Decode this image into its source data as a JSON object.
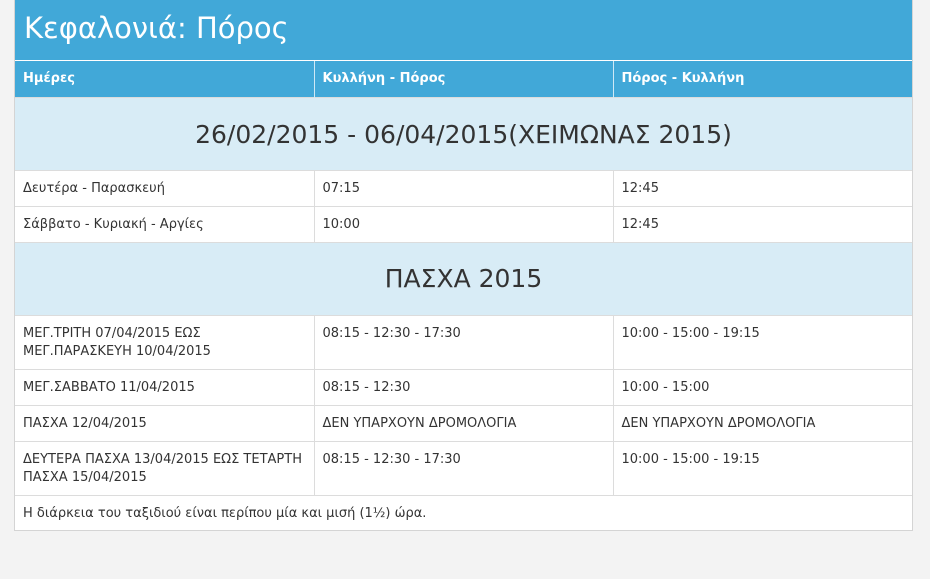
{
  "page": {
    "title": "Κεφαλονιά: Πόρος"
  },
  "table": {
    "headers": [
      "Ημέρες",
      "Κυλλήνη - Πόρος",
      "Πόρος - Κυλλήνη"
    ],
    "sections": [
      {
        "heading": "26/02/2015 - 06/04/2015(ΧΕΙΜΩΝΑΣ 2015)",
        "rows": [
          [
            "Δευτέρα - Παρασκευή",
            "07:15",
            "12:45"
          ],
          [
            "Σάββατο - Κυριακή - Αργίες",
            "10:00",
            "12:45"
          ]
        ]
      },
      {
        "heading": "ΠΑΣΧΑ 2015",
        "rows": [
          [
            "ΜΕΓ.ΤΡΙΤΗ 07/04/2015 ΕΩΣ ΜΕΓ.ΠΑΡΑΣΚΕΥΗ 10/04/2015",
            "08:15 - 12:30 - 17:30",
            "10:00 - 15:00 - 19:15"
          ],
          [
            "ΜΕΓ.ΣΑΒΒΑΤΟ 11/04/2015",
            "08:15 - 12:30",
            "10:00 - 15:00"
          ],
          [
            "ΠΑΣΧΑ 12/04/2015",
            "ΔΕΝ ΥΠΑΡΧΟΥΝ ΔΡΟΜΟΛΟΓΙΑ",
            "ΔΕΝ ΥΠΑΡΧΟΥΝ ΔΡΟΜΟΛΟΓΙΑ"
          ],
          [
            "ΔΕΥΤΕΡΑ ΠΑΣΧΑ 13/04/2015 ΕΩΣ ΤΕΤΑΡΤΗ ΠΑΣΧΑ 15/04/2015",
            "08:15 - 12:30 - 17:30",
            "10:00 - 15:00 - 19:15"
          ]
        ]
      }
    ],
    "note": "Η διάρκεια του ταξιδιού είναι περίπου μία και μισή (1½) ώρα."
  },
  "colors": {
    "header_bg": "#41a8d8",
    "section_bg": "#d8ecf6"
  }
}
